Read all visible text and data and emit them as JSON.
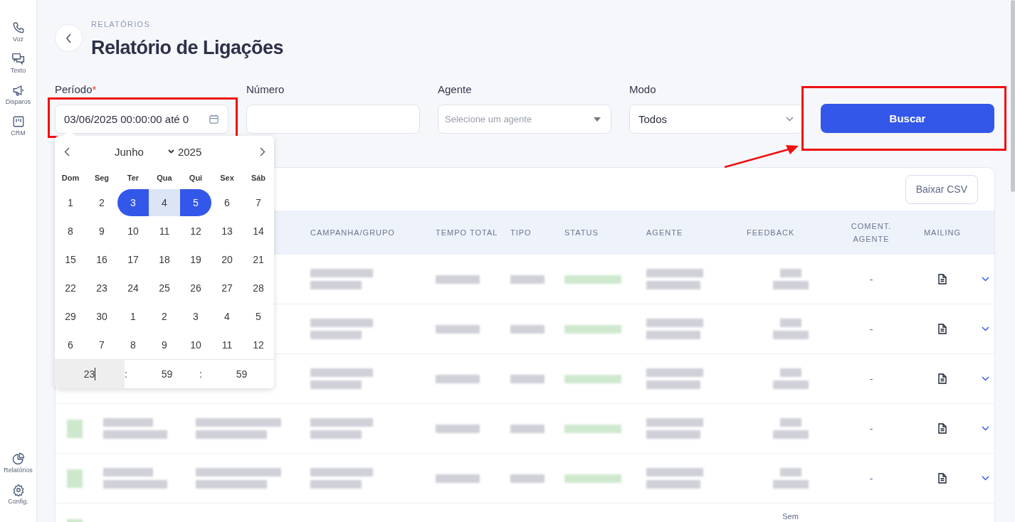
{
  "sidebar": {
    "top_items": [
      {
        "label": "Voz"
      },
      {
        "label": "Texto"
      },
      {
        "label": "Disparos"
      },
      {
        "label": "CRM"
      }
    ],
    "bottom_items": [
      {
        "label": "Relatórios"
      },
      {
        "label": "Config."
      }
    ]
  },
  "breadcrumb": "RELATÓRIOS",
  "title": "Relatório de Ligações",
  "filters": [
    {
      "kind": "date",
      "label": "Período",
      "required_mark": "*",
      "value": "03/06/2025 00:00:00 até 0",
      "highlighted": true
    },
    {
      "kind": "text",
      "label": "Número",
      "highlighted": false
    },
    {
      "kind": "select",
      "label": "Agente",
      "placeholder": "Selecione um agente",
      "highlighted": false
    },
    {
      "kind": "select",
      "label": "Modo",
      "value": "Todos",
      "highlighted": false
    }
  ],
  "search_button": {
    "label": "Buscar",
    "highlighted": true
  },
  "annotation_arrow": true,
  "date_picker": {
    "open": true,
    "month": "Junho",
    "year": "2025",
    "weekdays": [
      "Dom",
      "Seg",
      "Ter",
      "Qua",
      "Qui",
      "Sex",
      "Sáb"
    ],
    "days": [
      {
        "label": "1",
        "kind": "day"
      },
      {
        "label": "2",
        "kind": "day"
      },
      {
        "label": "3",
        "kind": "range-start"
      },
      {
        "label": "4",
        "kind": "in-range"
      },
      {
        "label": "5",
        "kind": "range-end"
      },
      {
        "label": "6",
        "kind": "day"
      },
      {
        "label": "7",
        "kind": "day"
      },
      {
        "label": "8",
        "kind": "day"
      },
      {
        "label": "9",
        "kind": "day"
      },
      {
        "label": "10",
        "kind": "day"
      },
      {
        "label": "11",
        "kind": "day"
      },
      {
        "label": "12",
        "kind": "day"
      },
      {
        "label": "13",
        "kind": "day"
      },
      {
        "label": "14",
        "kind": "day"
      },
      {
        "label": "15",
        "kind": "day"
      },
      {
        "label": "16",
        "kind": "day"
      },
      {
        "label": "17",
        "kind": "day"
      },
      {
        "label": "18",
        "kind": "day"
      },
      {
        "label": "19",
        "kind": "day"
      },
      {
        "label": "20",
        "kind": "day"
      },
      {
        "label": "21",
        "kind": "day"
      },
      {
        "label": "22",
        "kind": "day"
      },
      {
        "label": "23",
        "kind": "day"
      },
      {
        "label": "24",
        "kind": "day"
      },
      {
        "label": "25",
        "kind": "day"
      },
      {
        "label": "26",
        "kind": "day"
      },
      {
        "label": "27",
        "kind": "day"
      },
      {
        "label": "28",
        "kind": "day"
      },
      {
        "label": "29",
        "kind": "day"
      },
      {
        "label": "30",
        "kind": "day"
      },
      {
        "label": "1",
        "kind": "day"
      },
      {
        "label": "2",
        "kind": "day"
      },
      {
        "label": "3",
        "kind": "day"
      },
      {
        "label": "4",
        "kind": "day"
      },
      {
        "label": "5",
        "kind": "day"
      },
      {
        "label": "6",
        "kind": "day"
      },
      {
        "label": "7",
        "kind": "day"
      },
      {
        "label": "8",
        "kind": "day"
      },
      {
        "label": "9",
        "kind": "day"
      },
      {
        "label": "10",
        "kind": "day"
      },
      {
        "label": "11",
        "kind": "day"
      },
      {
        "label": "12",
        "kind": "day"
      }
    ],
    "time": {
      "hours": "23",
      "separator_1": ":",
      "minutes": "59",
      "separator_2": ":",
      "seconds": "59"
    }
  },
  "table": {
    "download_button": "Baixar CSV",
    "columns": [
      "CAMPANHA/GRUPO",
      "TEMPO TOTAL",
      "TIPO",
      "STATUS",
      "AGENTE",
      "FEEDBACK",
      "COMENT. AGENTE",
      "MAILING"
    ],
    "rows": [
      {
        "comment": "-"
      },
      {
        "comment": "-"
      },
      {
        "comment": "-"
      },
      {
        "comment": "-"
      },
      {
        "comment": "-"
      },
      {
        "feedback": "Sem"
      }
    ]
  }
}
